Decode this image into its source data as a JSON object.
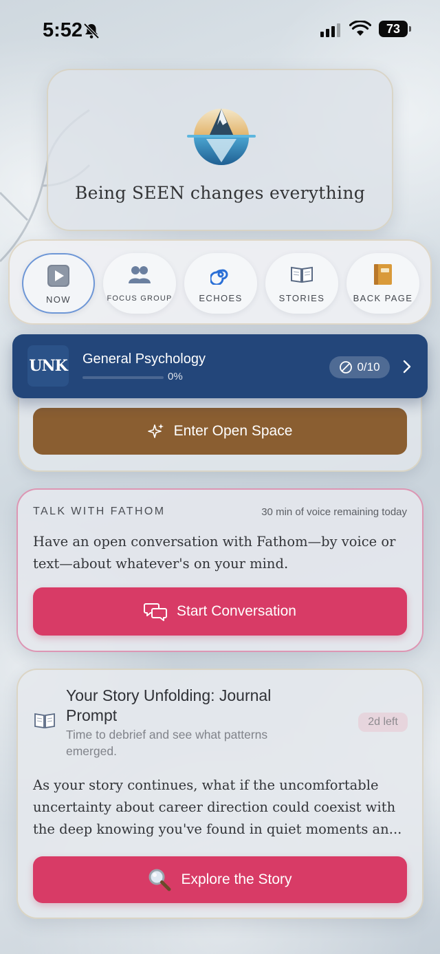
{
  "status_bar": {
    "time": "5:52",
    "battery": "73",
    "icons": [
      "bell-slash-icon",
      "cellular-signal-icon",
      "wifi-icon",
      "battery-icon"
    ]
  },
  "hero": {
    "title": "Being SEEN changes everything",
    "logo_icon": "iceberg-logo-icon"
  },
  "nav": {
    "items": [
      {
        "label": "NOW",
        "icon": "play-button-icon",
        "active": true
      },
      {
        "label": "FOCUS GROUP",
        "icon": "people-icon",
        "active": false
      },
      {
        "label": "ECHOES",
        "icon": "cyclone-icon",
        "active": false
      },
      {
        "label": "STORIES",
        "icon": "open-book-icon",
        "active": false
      },
      {
        "label": "BACK PAGE",
        "icon": "notebook-icon",
        "active": false
      }
    ]
  },
  "course": {
    "logo_text": "UNK",
    "title": "General Psychology",
    "progress_text": "0%",
    "progress": 0,
    "count": "0/10",
    "color": "#23467a"
  },
  "open_space": {
    "button_label": "Enter Open Space",
    "button_icon": "sparkles-icon",
    "color": "#8a5e31"
  },
  "talk": {
    "heading": "TALK WITH FATHOM",
    "remaining": "30 min of voice remaining today",
    "body": "Have an open conversation with Fathom—by voice or text—about whatever's on your mind.",
    "button_label": "Start Conversation",
    "button_icon": "chat-bubbles-icon",
    "color": "#d83b66"
  },
  "story": {
    "title": "Your Story Unfolding: Journal Prompt",
    "subtitle": "Time to debrief and see what patterns emerged.",
    "badge": "2d left",
    "icon": "open-book-icon",
    "body": "As your story continues, what if the uncomfortable uncertainty about career direction could coexist with the deep knowing you've found in quiet moments an...",
    "button_label": "Explore the Story",
    "button_icon": "magnifying-glass-icon"
  }
}
